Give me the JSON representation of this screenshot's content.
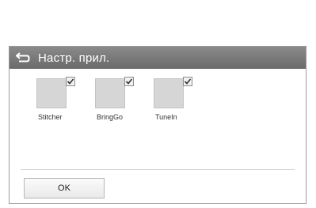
{
  "header": {
    "back_icon": "back-arrow-icon",
    "title": "Настр. прил."
  },
  "apps": [
    {
      "label": "Stitcher",
      "checked": true
    },
    {
      "label": "BringGo",
      "checked": true
    },
    {
      "label": "TuneIn",
      "checked": true
    }
  ],
  "footer": {
    "ok_label": "OK"
  }
}
